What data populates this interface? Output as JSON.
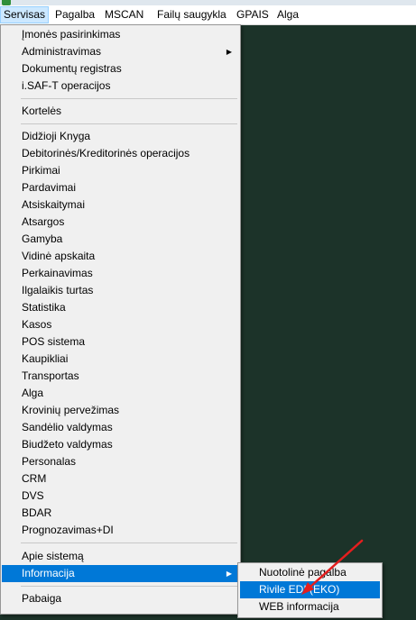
{
  "menubar": {
    "items": [
      "Servisas",
      "Pagalba",
      "MSCAN",
      "Failų saugykla",
      "GPAIS",
      "Alga"
    ]
  },
  "servisas_menu": {
    "group1": [
      "Įmonės pasirinkimas",
      "Administravimas",
      "Dokumentų registras",
      "i.SAF-T operacijos"
    ],
    "group2": [
      "Kortelės"
    ],
    "group3": [
      "Didžioji Knyga",
      "Debitorinės/Kreditorinės operacijos",
      "Pirkimai",
      "Pardavimai",
      "Atsiskaitymai",
      "Atsargos",
      "Gamyba",
      "Vidinė apskaita",
      "Perkainavimas",
      "Ilgalaikis turtas",
      "Statistika",
      "Kasos",
      "POS sistema",
      "Kaupikliai",
      "Transportas",
      "Alga",
      "Krovinių pervežimas",
      "Sandėlio valdymas",
      "Biudžeto valdymas",
      "Personalas",
      "CRM",
      "DVS",
      "BDAR",
      "Prognozavimas+DI"
    ],
    "group4": [
      "Apie sistemą",
      "Informacija"
    ],
    "group5": [
      "Pabaiga"
    ],
    "highlighted": "Informacija",
    "submenu_arrow": "▶"
  },
  "informacija_submenu": {
    "items": [
      "Nuotolinė pagalba",
      "Rivile EDI (EKO)",
      "WEB informacija"
    ],
    "highlighted": "Rivile EDI (EKO)"
  },
  "annotation": {
    "arrow_color": "#e41e1e"
  }
}
